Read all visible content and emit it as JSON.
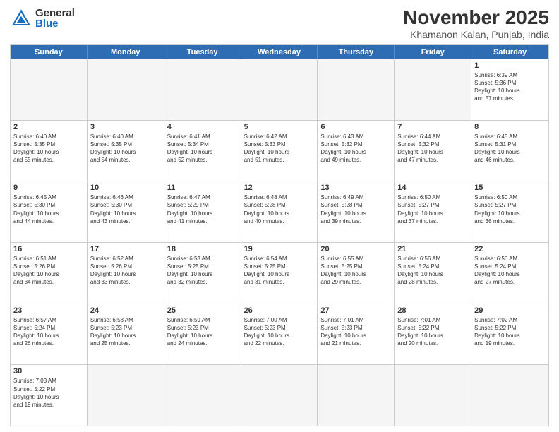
{
  "header": {
    "logo": {
      "general": "General",
      "blue": "Blue"
    },
    "title": "November 2025",
    "location": "Khamanon Kalan, Punjab, India"
  },
  "days": [
    "Sunday",
    "Monday",
    "Tuesday",
    "Wednesday",
    "Thursday",
    "Friday",
    "Saturday"
  ],
  "weeks": [
    [
      {
        "num": "",
        "empty": true
      },
      {
        "num": "",
        "empty": true
      },
      {
        "num": "",
        "empty": true
      },
      {
        "num": "",
        "empty": true
      },
      {
        "num": "",
        "empty": true
      },
      {
        "num": "",
        "empty": true
      },
      {
        "num": "1",
        "sunrise": "6:39 AM",
        "sunset": "5:36 PM",
        "hours": "10",
        "minutes": "57"
      }
    ],
    [
      {
        "num": "2",
        "sunrise": "6:40 AM",
        "sunset": "5:35 PM",
        "hours": "10",
        "minutes": "55"
      },
      {
        "num": "3",
        "sunrise": "6:40 AM",
        "sunset": "5:35 PM",
        "hours": "10",
        "minutes": "54"
      },
      {
        "num": "4",
        "sunrise": "6:41 AM",
        "sunset": "5:34 PM",
        "hours": "10",
        "minutes": "52"
      },
      {
        "num": "5",
        "sunrise": "6:42 AM",
        "sunset": "5:33 PM",
        "hours": "10",
        "minutes": "51"
      },
      {
        "num": "6",
        "sunrise": "6:43 AM",
        "sunset": "5:32 PM",
        "hours": "10",
        "minutes": "49"
      },
      {
        "num": "7",
        "sunrise": "6:44 AM",
        "sunset": "5:32 PM",
        "hours": "10",
        "minutes": "47"
      },
      {
        "num": "8",
        "sunrise": "6:45 AM",
        "sunset": "5:31 PM",
        "hours": "10",
        "minutes": "46"
      }
    ],
    [
      {
        "num": "9",
        "sunrise": "6:45 AM",
        "sunset": "5:30 PM",
        "hours": "10",
        "minutes": "44"
      },
      {
        "num": "10",
        "sunrise": "6:46 AM",
        "sunset": "5:30 PM",
        "hours": "10",
        "minutes": "43"
      },
      {
        "num": "11",
        "sunrise": "6:47 AM",
        "sunset": "5:29 PM",
        "hours": "10",
        "minutes": "41"
      },
      {
        "num": "12",
        "sunrise": "6:48 AM",
        "sunset": "5:28 PM",
        "hours": "10",
        "minutes": "40"
      },
      {
        "num": "13",
        "sunrise": "6:49 AM",
        "sunset": "5:28 PM",
        "hours": "10",
        "minutes": "39"
      },
      {
        "num": "14",
        "sunrise": "6:50 AM",
        "sunset": "5:27 PM",
        "hours": "10",
        "minutes": "37"
      },
      {
        "num": "15",
        "sunrise": "6:50 AM",
        "sunset": "5:27 PM",
        "hours": "10",
        "minutes": "36"
      }
    ],
    [
      {
        "num": "16",
        "sunrise": "6:51 AM",
        "sunset": "5:26 PM",
        "hours": "10",
        "minutes": "34"
      },
      {
        "num": "17",
        "sunrise": "6:52 AM",
        "sunset": "5:26 PM",
        "hours": "10",
        "minutes": "33"
      },
      {
        "num": "18",
        "sunrise": "6:53 AM",
        "sunset": "5:25 PM",
        "hours": "10",
        "minutes": "32"
      },
      {
        "num": "19",
        "sunrise": "6:54 AM",
        "sunset": "5:25 PM",
        "hours": "10",
        "minutes": "31"
      },
      {
        "num": "20",
        "sunrise": "6:55 AM",
        "sunset": "5:25 PM",
        "hours": "10",
        "minutes": "29"
      },
      {
        "num": "21",
        "sunrise": "6:56 AM",
        "sunset": "5:24 PM",
        "hours": "10",
        "minutes": "28"
      },
      {
        "num": "22",
        "sunrise": "6:56 AM",
        "sunset": "5:24 PM",
        "hours": "10",
        "minutes": "27"
      }
    ],
    [
      {
        "num": "23",
        "sunrise": "6:57 AM",
        "sunset": "5:24 PM",
        "hours": "10",
        "minutes": "26"
      },
      {
        "num": "24",
        "sunrise": "6:58 AM",
        "sunset": "5:23 PM",
        "hours": "10",
        "minutes": "25"
      },
      {
        "num": "25",
        "sunrise": "6:59 AM",
        "sunset": "5:23 PM",
        "hours": "10",
        "minutes": "24"
      },
      {
        "num": "26",
        "sunrise": "7:00 AM",
        "sunset": "5:23 PM",
        "hours": "10",
        "minutes": "22"
      },
      {
        "num": "27",
        "sunrise": "7:01 AM",
        "sunset": "5:23 PM",
        "hours": "10",
        "minutes": "21"
      },
      {
        "num": "28",
        "sunrise": "7:01 AM",
        "sunset": "5:22 PM",
        "hours": "10",
        "minutes": "20"
      },
      {
        "num": "29",
        "sunrise": "7:02 AM",
        "sunset": "5:22 PM",
        "hours": "10",
        "minutes": "19"
      }
    ],
    [
      {
        "num": "30",
        "sunrise": "7:03 AM",
        "sunset": "5:22 PM",
        "hours": "10",
        "minutes": "19"
      },
      {
        "num": "",
        "empty": true
      },
      {
        "num": "",
        "empty": true
      },
      {
        "num": "",
        "empty": true
      },
      {
        "num": "",
        "empty": true
      },
      {
        "num": "",
        "empty": true
      },
      {
        "num": "",
        "empty": true
      }
    ]
  ]
}
